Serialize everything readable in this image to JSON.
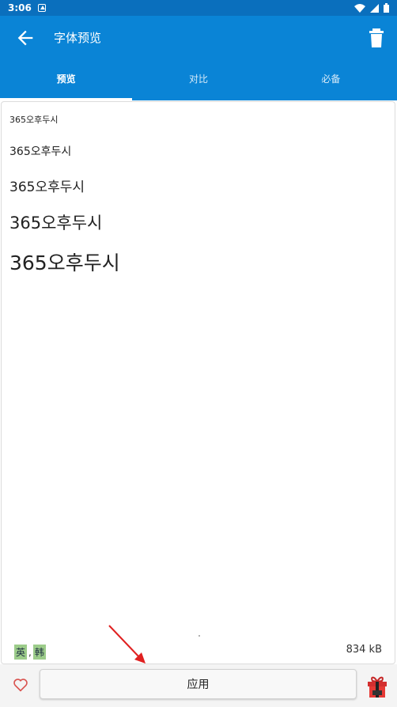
{
  "status_bar": {
    "time": "3:06"
  },
  "app_bar": {
    "title": "字体预览"
  },
  "tabs": [
    {
      "label": "预览",
      "active": true
    },
    {
      "label": "对比",
      "active": false
    },
    {
      "label": "必备",
      "active": false
    }
  ],
  "preview": {
    "samples": [
      "365오후두시",
      "365오후두시",
      "365오후두시",
      "365오후두시",
      "365오후두시"
    ]
  },
  "footer_info": {
    "languages": [
      "英",
      "韩"
    ],
    "separator": ",",
    "file_size": "834 kB"
  },
  "bottom_bar": {
    "apply_label": "应用"
  },
  "colors": {
    "primary": "#0a84d6",
    "status_bar": "#0a6fbd",
    "lang_tag": "#9ccc8a",
    "arrow": "#e02020",
    "heart": "#d9534f"
  },
  "icons": {
    "back": "arrow-left-icon",
    "delete": "trash-icon",
    "favorite": "heart-outline-icon",
    "gift": "gift-icon"
  }
}
